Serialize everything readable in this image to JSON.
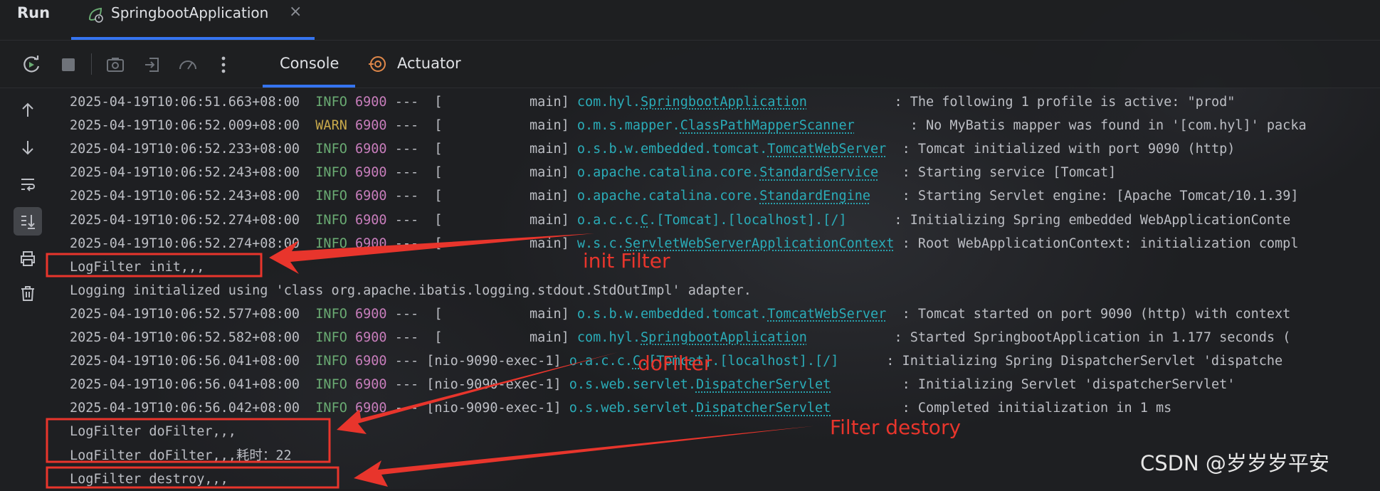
{
  "header": {
    "run_label": "Run",
    "tab_label": "SpringbootApplication",
    "tab_close": "×"
  },
  "toolbar": {
    "tabs": [
      {
        "label": "Console",
        "active": true
      },
      {
        "label": "Actuator",
        "active": false
      }
    ]
  },
  "colors": {
    "accent": "#3574f0",
    "info": "#6aab73",
    "warn": "#c8a94b",
    "pid": "#c77dbb",
    "logger": "#2aacb8",
    "annotation": "#e8352c"
  },
  "icons": {
    "toolbar": [
      "rerun-icon",
      "stop-icon",
      "screenshot-icon",
      "restore-layout-icon",
      "dashboard-icon",
      "more-icon"
    ],
    "sidebar": [
      "scroll-up-icon",
      "scroll-down-icon",
      "soft-wrap-icon",
      "scroll-to-end-icon",
      "print-icon",
      "clear-icon"
    ]
  },
  "console": {
    "lines": [
      {
        "ts": "2025-04-19T10:06:51.663+08:00",
        "level": "INFO",
        "pid": "6900",
        "thread": "---  [           main]",
        "logger_prefix": "com.hyl.",
        "logger_class": "SpringbootApplication",
        "pad": "           ",
        "message": ": The following 1 profile is active: \"prod\""
      },
      {
        "ts": "2025-04-19T10:06:52.009+08:00",
        "level": "WARN",
        "pid": "6900",
        "thread": "---  [           main]",
        "logger_prefix": "o.m.s.mapper.",
        "logger_class": "ClassPathMapperScanner",
        "pad": "       ",
        "message": ": No MyBatis mapper was found in '[com.hyl]' packa"
      },
      {
        "ts": "2025-04-19T10:06:52.233+08:00",
        "level": "INFO",
        "pid": "6900",
        "thread": "---  [           main]",
        "logger_prefix": "o.s.b.w.embedded.tomcat.",
        "logger_class": "TomcatWebServer",
        "pad": "  ",
        "message": ": Tomcat initialized with port 9090 (http)"
      },
      {
        "ts": "2025-04-19T10:06:52.243+08:00",
        "level": "INFO",
        "pid": "6900",
        "thread": "---  [           main]",
        "logger_prefix": "o.apache.catalina.core.",
        "logger_class": "StandardService",
        "pad": "   ",
        "message": ": Starting service [Tomcat]"
      },
      {
        "ts": "2025-04-19T10:06:52.243+08:00",
        "level": "INFO",
        "pid": "6900",
        "thread": "---  [           main]",
        "logger_prefix": "o.apache.catalina.core.",
        "logger_class": "StandardEngine",
        "pad": "    ",
        "message": ": Starting Servlet engine: [Apache Tomcat/10.1.39]"
      },
      {
        "ts": "2025-04-19T10:06:52.274+08:00",
        "level": "INFO",
        "pid": "6900",
        "thread": "---  [           main]",
        "logger_prefix": "o.a.c.c.",
        "logger_class": "C",
        "logger_suffix": ".[Tomcat].[localhost].[/]",
        "pad": "      ",
        "message": ": Initializing Spring embedded WebApplicationConte"
      },
      {
        "ts": "2025-04-19T10:06:52.274+08:00",
        "level": "INFO",
        "pid": "6900",
        "thread": "---  [           main]",
        "logger_prefix": "w.s.c.",
        "logger_class": "ServletWebServerApplicationContext",
        "pad": " ",
        "message": ": Root WebApplicationContext: initialization compl"
      },
      {
        "plain": "LogFilter init,,,"
      },
      {
        "plain": "Logging initialized using 'class org.apache.ibatis.logging.stdout.StdOutImpl' adapter."
      },
      {
        "ts": "2025-04-19T10:06:52.577+08:00",
        "level": "INFO",
        "pid": "6900",
        "thread": "---  [           main]",
        "logger_prefix": "o.s.b.w.embedded.tomcat.",
        "logger_class": "TomcatWebServer",
        "pad": "  ",
        "message": ": Tomcat started on port 9090 (http) with context"
      },
      {
        "ts": "2025-04-19T10:06:52.582+08:00",
        "level": "INFO",
        "pid": "6900",
        "thread": "---  [           main]",
        "logger_prefix": "com.hyl.",
        "logger_class": "SpringbootApplication",
        "pad": "           ",
        "message": ": Started SpringbootApplication in 1.177 seconds ("
      },
      {
        "ts": "2025-04-19T10:06:56.041+08:00",
        "level": "INFO",
        "pid": "6900",
        "thread": "--- [nio-9090-exec-1]",
        "logger_prefix": "o.a.c.c.",
        "logger_class": "C",
        "logger_suffix": ".[Tomcat].[localhost].[/]",
        "pad": "      ",
        "message": ": Initializing Spring DispatcherServlet 'dispatche"
      },
      {
        "ts": "2025-04-19T10:06:56.041+08:00",
        "level": "INFO",
        "pid": "6900",
        "thread": "--- [nio-9090-exec-1]",
        "logger_prefix": "o.s.web.servlet.",
        "logger_class": "DispatcherServlet",
        "pad": "         ",
        "message": ": Initializing Servlet 'dispatcherServlet'"
      },
      {
        "ts": "2025-04-19T10:06:56.042+08:00",
        "level": "INFO",
        "pid": "6900",
        "thread": "--- [nio-9090-exec-1]",
        "logger_prefix": "o.s.web.servlet.",
        "logger_class": "DispatcherServlet",
        "pad": "         ",
        "message": ": Completed initialization in 1 ms"
      },
      {
        "plain": "LogFilter doFilter,,,"
      },
      {
        "plain": "LogFilter doFilter,,,耗时：22"
      },
      {
        "plain": "LogFilter destroy,,,"
      }
    ]
  },
  "annotations": {
    "init": "init Filter",
    "dofilter": "doFilter",
    "destroy": "Filter destory"
  },
  "watermark": "CSDN @岁岁岁平安"
}
